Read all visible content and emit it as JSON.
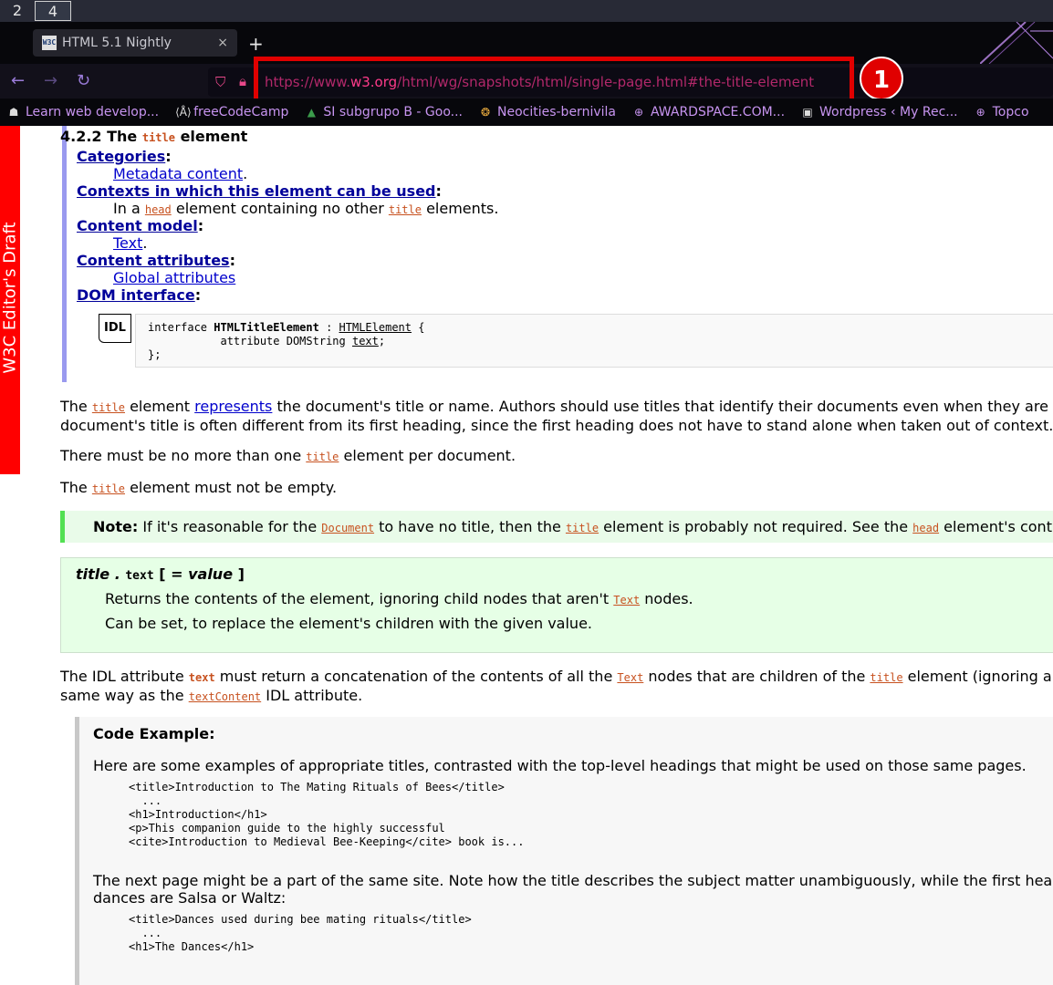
{
  "workspaces": [
    "2",
    "4"
  ],
  "tab": {
    "favicon": "W3C",
    "title": "HTML 5.1 Nightly",
    "close": "×",
    "new_tab": "+"
  },
  "nav": {
    "back": "←",
    "forward": "→",
    "reload": "↻"
  },
  "url": {
    "prefix": "https://www.",
    "host": "w3.org",
    "path": "/html/wg/snapshots/html/single-page.html#the-title-element"
  },
  "annotation_marker": "1",
  "bookmarks": [
    {
      "icon": "mdn-icon",
      "label": "Learn web develop..."
    },
    {
      "icon": "freecodecamp-icon",
      "label": "freeCodeCamp"
    },
    {
      "icon": "drive-icon",
      "label": "SI subgrupo B - Goo..."
    },
    {
      "icon": "neocities-icon",
      "label": "Neocities-bernivila"
    },
    {
      "icon": "globe-icon",
      "label": "AWARDSPACE.COM..."
    },
    {
      "icon": "wordpress-icon",
      "label": "Wordpress ‹ My Rec..."
    },
    {
      "icon": "globe-icon",
      "label": "Topco"
    }
  ],
  "draft_banner": "W3C Editor's Draft",
  "section": {
    "number": "4.2.2 The",
    "element": "title",
    "suffix": "element"
  },
  "definition": {
    "categories_label": "Categories",
    "categories_value": "Metadata content",
    "contexts_label": "Contexts in which this element can be used",
    "contexts_pre": "In a",
    "contexts_head": "head",
    "contexts_mid": "element containing no other",
    "contexts_title": "title",
    "contexts_post": "elements.",
    "content_model_label": "Content model",
    "content_model_value": "Text",
    "content_attrs_label": "Content attributes",
    "content_attrs_value": "Global attributes",
    "dom_label": "DOM interface"
  },
  "idl": {
    "label": "IDL",
    "line1_a": "interface ",
    "line1_name": "HTMLTitleElement",
    "line1_b": " : ",
    "line1_parent": "HTMLElement",
    "line1_c": " {",
    "line2_a": "           attribute DOMString ",
    "line2_attr": "text",
    "line2_b": ";",
    "line3": "};"
  },
  "paragraphs": {
    "p1_a": "The",
    "p1_code": "title",
    "p1_b": "element",
    "p1_link": "represents",
    "p1_c": "the document's title or name. Authors should use titles that identify their documents even when they are",
    "p1_line2": "document's title is often different from its first heading, since the first heading does not have to stand alone when taken out of context.",
    "p2_a": "There must be no more than one",
    "p2_code": "title",
    "p2_b": "element per document.",
    "p3_a": "The",
    "p3_code": "title",
    "p3_b": "element must not be empty."
  },
  "note": {
    "label": "Note:",
    "a": "If it's reasonable for the",
    "code1": "Document",
    "b": "to have no title, then the",
    "code2": "title",
    "c": "element is probably not required. See the",
    "code3": "head",
    "d": "element's cont"
  },
  "domintro": {
    "sig_obj": "title",
    "sig_dot": " . ",
    "sig_attr": "text",
    "sig_rest": " [ = ",
    "sig_value": "value",
    "sig_end": " ]",
    "desc1_a": "Returns the contents of the element, ignoring child nodes that aren't",
    "desc1_code": "Text",
    "desc1_b": "nodes.",
    "desc2": "Can be set, to replace the element's children with the given value."
  },
  "idl_para": {
    "a": "The IDL attribute",
    "code1": "text",
    "b": "must return a concatenation of the contents of all the",
    "code2": "Text",
    "c": "nodes that are children of the",
    "code3": "title",
    "d": "element (ignoring ar",
    "line2_a": "same way as the",
    "line2_code": "textContent",
    "line2_b": "IDL attribute."
  },
  "example": {
    "title": "Code Example:",
    "intro": "Here are some examples of appropriate titles, contrasted with the top-level headings that might be used on those same pages.",
    "code1": "<title>Introduction to The Mating Rituals of Bees</title>\n  ...\n<h1>Introduction</h1>\n<p>This companion guide to the highly successful\n<cite>Introduction to Medieval Bee-Keeping</cite> book is...",
    "mid_line1": "The next page might be a part of the same site. Note how the title describes the subject matter unambiguously, while the first hea",
    "mid_line2": "dances are Salsa or Waltz:",
    "code2": "<title>Dances used during bee mating rituals</title>\n  ...\n<h1>The Dances</h1>"
  }
}
